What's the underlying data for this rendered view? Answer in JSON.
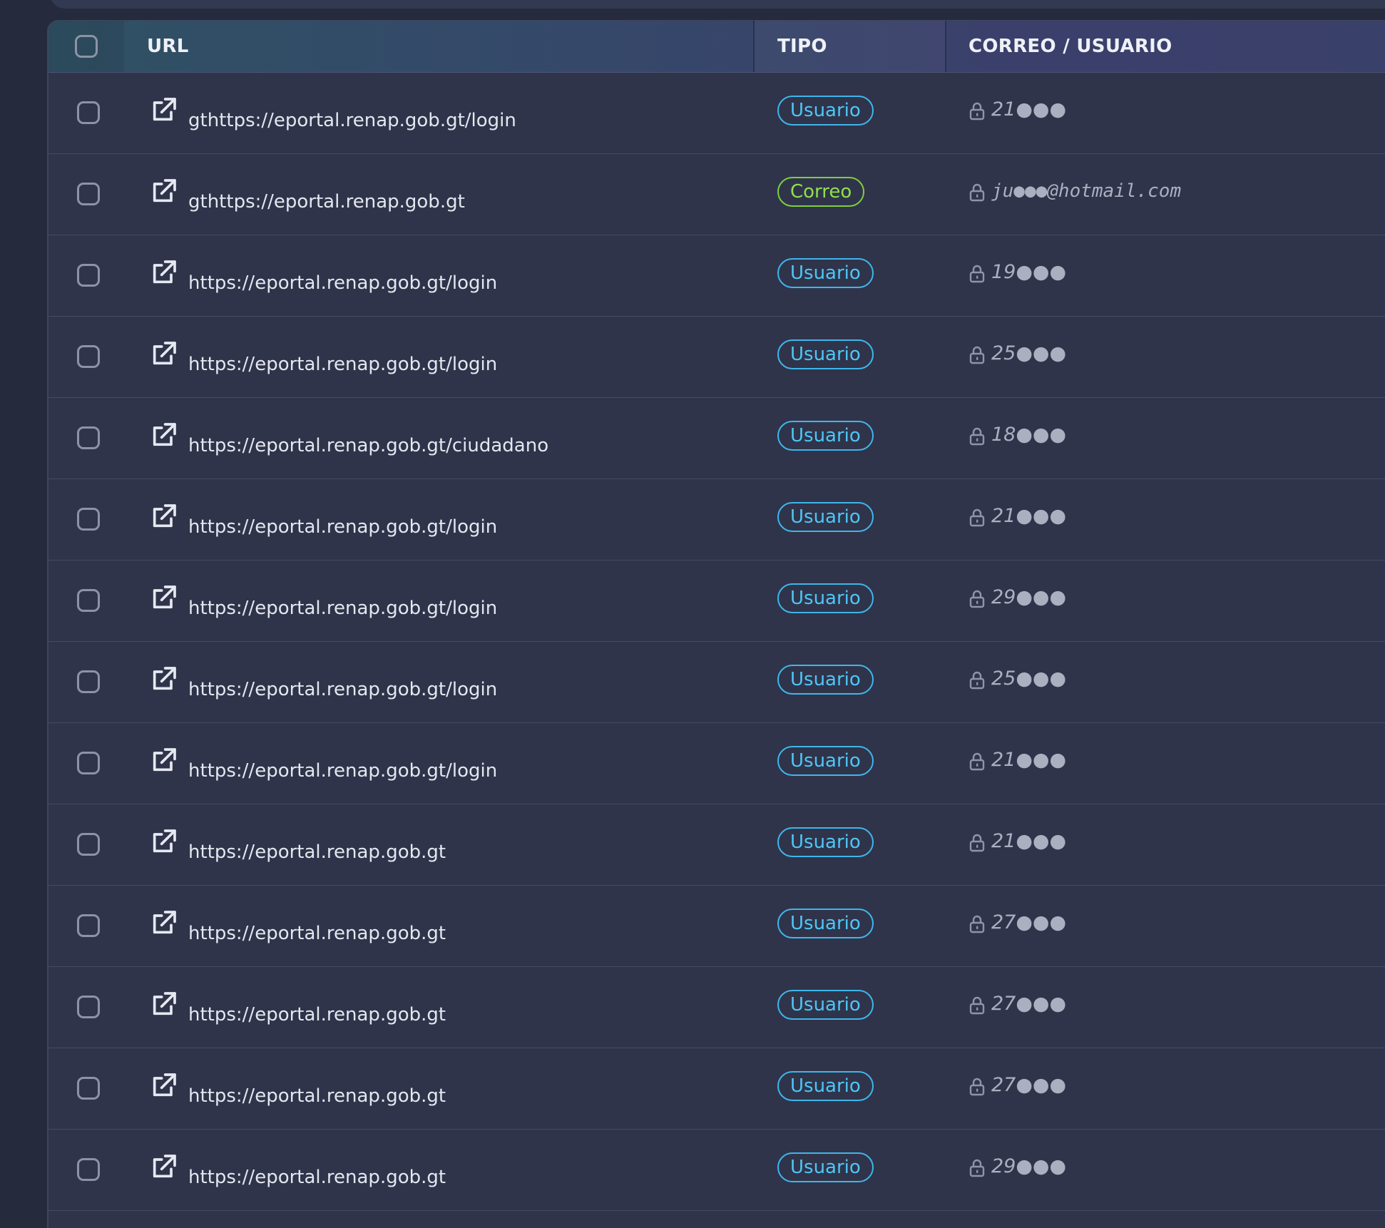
{
  "table": {
    "headers": {
      "url": "URL",
      "tipo": "TIPO",
      "correo": "CORREO / USUARIO"
    },
    "rows": [
      {
        "url": "gthttps://eportal.renap.gob.gt/login",
        "tipo": "Usuario",
        "credential": "21●●●"
      },
      {
        "url": "gthttps://eportal.renap.gob.gt",
        "tipo": "Correo",
        "credential": "ju●●●@hotmail.com"
      },
      {
        "url": "https://eportal.renap.gob.gt/login",
        "tipo": "Usuario",
        "credential": "19●●●"
      },
      {
        "url": "https://eportal.renap.gob.gt/login",
        "tipo": "Usuario",
        "credential": "25●●●"
      },
      {
        "url": "https://eportal.renap.gob.gt/ciudadano",
        "tipo": "Usuario",
        "credential": "18●●●"
      },
      {
        "url": "https://eportal.renap.gob.gt/login",
        "tipo": "Usuario",
        "credential": "21●●●"
      },
      {
        "url": "https://eportal.renap.gob.gt/login",
        "tipo": "Usuario",
        "credential": "29●●●"
      },
      {
        "url": "https://eportal.renap.gob.gt/login",
        "tipo": "Usuario",
        "credential": "25●●●"
      },
      {
        "url": "https://eportal.renap.gob.gt/login",
        "tipo": "Usuario",
        "credential": "21●●●"
      },
      {
        "url": "https://eportal.renap.gob.gt",
        "tipo": "Usuario",
        "credential": "21●●●"
      },
      {
        "url": "https://eportal.renap.gob.gt",
        "tipo": "Usuario",
        "credential": "27●●●"
      },
      {
        "url": "https://eportal.renap.gob.gt",
        "tipo": "Usuario",
        "credential": "27●●●"
      },
      {
        "url": "https://eportal.renap.gob.gt",
        "tipo": "Usuario",
        "credential": "27●●●"
      },
      {
        "url": "https://eportal.renap.gob.gt",
        "tipo": "Usuario",
        "credential": "29●●●"
      }
    ]
  },
  "icons": {
    "row_link": "external-link-icon",
    "credential": "lock-icon"
  },
  "colors": {
    "usuario_badge": "#3fb6ea",
    "correo_badge": "#7ecf3b"
  }
}
